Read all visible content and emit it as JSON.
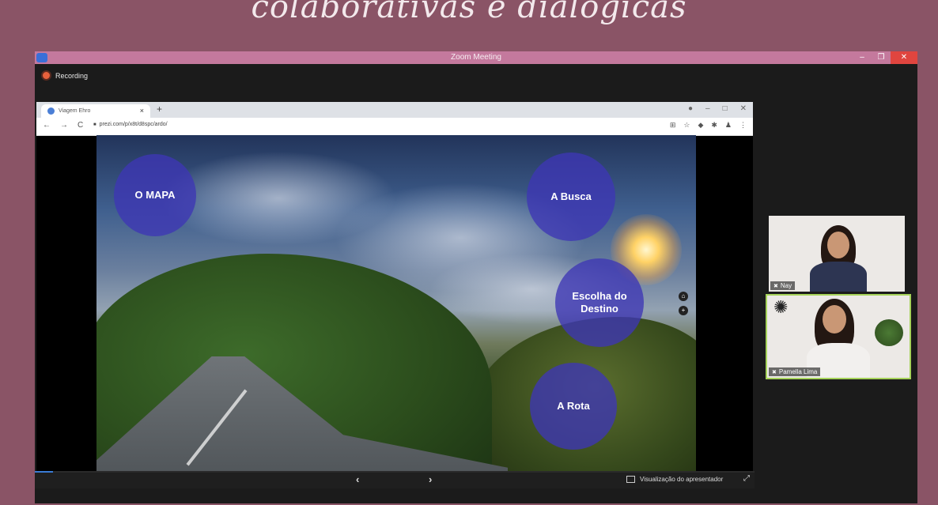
{
  "header_title": "colaborativas e dialógicas",
  "zoom": {
    "title": "Zoom Meeting",
    "recording": "Recording",
    "controls": {
      "minimize": "–",
      "maximize": "❐",
      "close": "✕"
    }
  },
  "browser": {
    "tab_title": "Viagem Ehro",
    "tab_close": "×",
    "new_tab": "+",
    "url": "prezi.com/p/x8t/d8spc/ardo/",
    "nav": {
      "back": "←",
      "forward": "→",
      "reload": "C"
    },
    "window_controls": [
      "●",
      "–",
      "□",
      "✕"
    ],
    "extensions": [
      "⊞",
      "☆",
      "◆",
      "✱",
      "♟",
      "⋮"
    ]
  },
  "slide": {
    "bubbles": {
      "mapa": "O MAPA",
      "busca": "A Busca",
      "destino": "Escolha do Destino",
      "rota": "A Rota"
    },
    "home": "⌂",
    "zoom_in": "+"
  },
  "prezi_bar": {
    "prev": "‹",
    "next": "›",
    "presenter_view": "Visualização do apresentador",
    "fullscreen": "⤢",
    "progress": 0.025
  },
  "participants": [
    {
      "name": "Nay"
    },
    {
      "name": "Pamella Lima"
    }
  ],
  "colors": {
    "background": "#8a5466",
    "zoom_titlebar": "#c4799d",
    "bubble": "#3d36b5",
    "active_speaker_border": "#a6d35a"
  }
}
